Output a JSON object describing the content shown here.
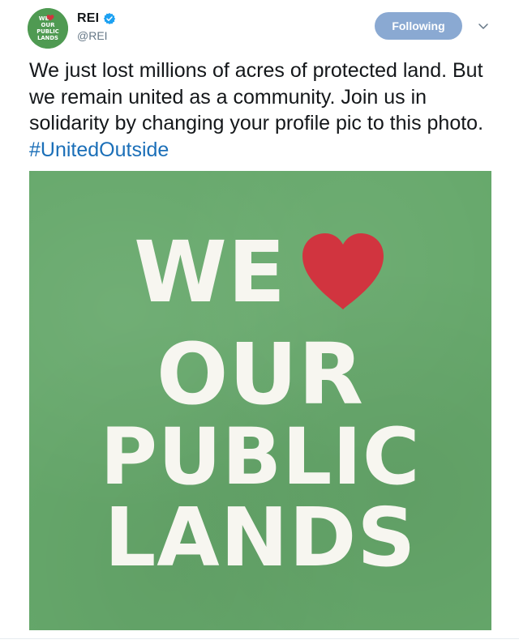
{
  "tweet": {
    "author": {
      "display_name": "REI",
      "handle": "@REI",
      "verified": true,
      "avatar_text": [
        "WE",
        "OUR",
        "PUBLIC",
        "LANDS"
      ]
    },
    "follow_button_label": "Following",
    "text_main": "We just lost millions of acres of protected land. But we remain united as a community. Join us in solidarity by changing your profile pic to this photo. ",
    "hashtag": "#UnitedOutside",
    "media": {
      "lines": [
        "WE",
        "OUR",
        "PUBLIC",
        "LANDS"
      ],
      "heart_icon": "heart-icon",
      "background_color": "#66a86b",
      "heart_color": "#d1343f"
    }
  },
  "icons": {
    "verified": "verified-badge-icon",
    "menu": "chevron-down-icon"
  },
  "colors": {
    "follow_button": "#8aa9d2",
    "hashtag": "#1b6fb8",
    "handle": "#657786"
  }
}
